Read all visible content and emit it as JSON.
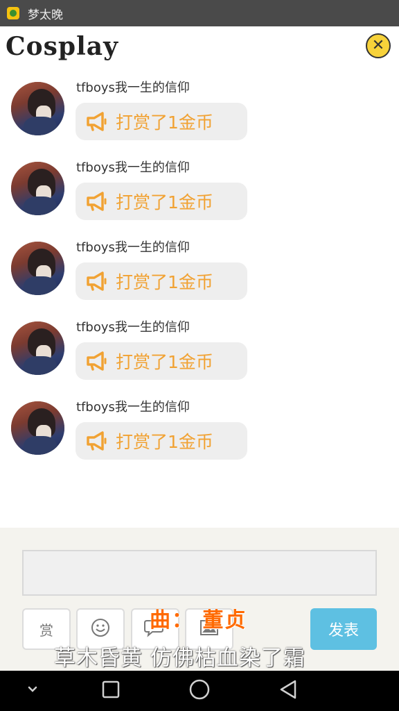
{
  "status_bar": {
    "app_name": "梦太晚"
  },
  "header": {
    "title": "Cosplay",
    "close_icon": "close-icon"
  },
  "messages": [
    {
      "username": "tfboys我一生的信仰",
      "text": "打赏了1金币"
    },
    {
      "username": "tfboys我一生的信仰",
      "text": "打赏了1金币"
    },
    {
      "username": "tfboys我一生的信仰",
      "text": "打赏了1金币"
    },
    {
      "username": "tfboys我一生的信仰",
      "text": "打赏了1金币"
    },
    {
      "username": "tfboys我一生的信仰",
      "text": "打赏了1金币"
    }
  ],
  "composer": {
    "input_value": "",
    "reward_label": "赏",
    "send_label": "发表"
  },
  "overlay": {
    "credit": "曲： 董贞",
    "lyric": "草木昏黄 仿佛枯血染了霜"
  },
  "colors": {
    "accent_orange": "#f1a233",
    "send_blue": "#5ec0e2",
    "close_yellow": "#f7d23a"
  }
}
